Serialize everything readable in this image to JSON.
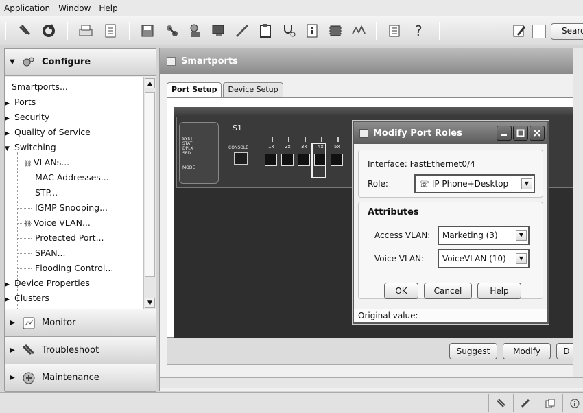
{
  "menubar": {
    "items": [
      "Application",
      "Window",
      "Help"
    ]
  },
  "toolbar": {
    "icons": [
      "tools-icon",
      "refresh-icon",
      "print-icon",
      "checklist-icon",
      "save-icon",
      "network-icon",
      "user-icon",
      "monitor-icon",
      "cable-icon",
      "clipboard-icon",
      "stethoscope-icon",
      "document-icon",
      "chip-icon",
      "graph-icon",
      "list-icon",
      "help-icon",
      "edit-icon"
    ],
    "search_label": "Search"
  },
  "nav": {
    "configure_label": "Configure",
    "tree": [
      {
        "label": "Smartports...",
        "kind": "link"
      },
      {
        "label": "Ports",
        "kind": "collapsed"
      },
      {
        "label": "Security",
        "kind": "collapsed"
      },
      {
        "label": "Quality of Service",
        "kind": "collapsed"
      },
      {
        "label": "Switching",
        "kind": "expanded"
      },
      {
        "label": "VLANs...",
        "kind": "child-icon"
      },
      {
        "label": "MAC Addresses...",
        "kind": "child"
      },
      {
        "label": "STP...",
        "kind": "child"
      },
      {
        "label": "IGMP Snooping...",
        "kind": "child"
      },
      {
        "label": "Voice VLAN...",
        "kind": "child-icon"
      },
      {
        "label": "Protected Port...",
        "kind": "child"
      },
      {
        "label": "SPAN...",
        "kind": "child"
      },
      {
        "label": "Flooding Control...",
        "kind": "child"
      },
      {
        "label": "Device Properties",
        "kind": "collapsed"
      },
      {
        "label": "Clusters",
        "kind": "collapsed"
      }
    ],
    "monitor_label": "Monitor",
    "troubleshoot_label": "Troubleshoot",
    "maintenance_label": "Maintenance"
  },
  "main": {
    "panel_title": "Smartports",
    "tabs": [
      "Port Setup",
      "Device Setup"
    ],
    "switch": {
      "name": "S1",
      "console_label": "CONSOLE",
      "mode_label": "MODE",
      "leds": [
        "SYST",
        "STAT",
        "DPLX",
        "SPD"
      ],
      "ports": [
        "1x",
        "2x",
        "3x",
        "4x",
        "5x"
      ]
    },
    "buttons": {
      "suggest": "Suggest",
      "modify": "Modify",
      "cut": "D"
    }
  },
  "dialog": {
    "title": "Modify Port Roles",
    "interface_text": "Interface: FastEthernet0/4",
    "role_label": "Role:",
    "role_value": "IP Phone+Desktop",
    "attributes_title": "Attributes",
    "access_vlan_label": "Access VLAN:",
    "access_vlan_value": "Marketing (3)",
    "voice_vlan_label": "Voice VLAN:",
    "voice_vlan_value": "VoiceVLAN (10)",
    "ok_label": "OK",
    "cancel_label": "Cancel",
    "help_label": "Help",
    "status_text": "Original value:"
  }
}
